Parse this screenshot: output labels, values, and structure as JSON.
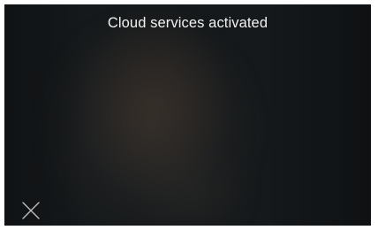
{
  "notification": {
    "message": "Cloud services activated"
  },
  "controls": {
    "close_icon": "close-icon"
  },
  "colors": {
    "screen_background": "#16191b",
    "text": "#f2f2f2",
    "icon_stroke": "#bdbdbd"
  }
}
